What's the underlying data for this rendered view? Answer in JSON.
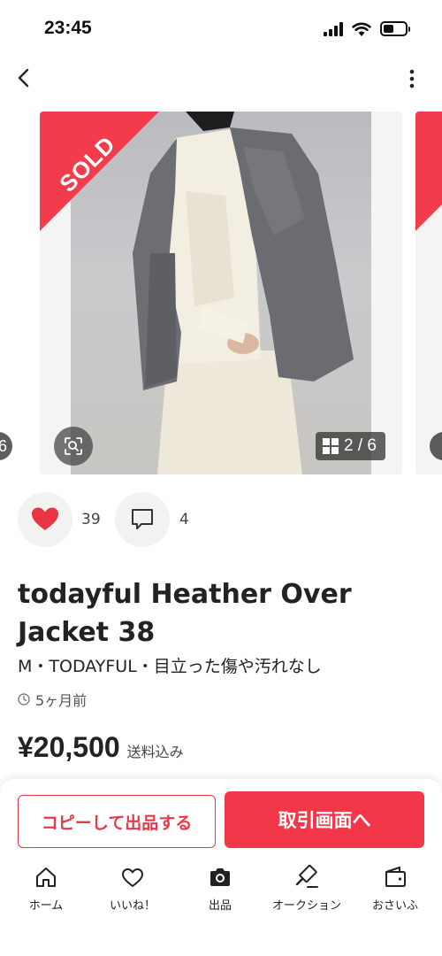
{
  "status_bar": {
    "time": "23:45"
  },
  "carousel": {
    "sold_label": "SOLD",
    "current_index": "2",
    "total": "6",
    "counter_text": "2 / 6",
    "prev_peek_text": "6"
  },
  "reactions": {
    "likes": "39",
    "comments": "4"
  },
  "item": {
    "title": "todayful Heather Over Jacket 38",
    "meta": "M・TODAYFUL・目立った傷や汚れなし",
    "posted": "5ヶ月前",
    "price": "¥20,500",
    "shipping": "送料込み"
  },
  "actions": {
    "copy_label": "コピーして出品する",
    "trade_label": "取引画面へ"
  },
  "tab_bar": {
    "items": [
      {
        "label": "ホーム",
        "icon": "home-icon"
      },
      {
        "label": "いいね！",
        "icon": "heart-outline-icon"
      },
      {
        "label": "出品",
        "icon": "camera-icon"
      },
      {
        "label": "オークション",
        "icon": "gavel-icon"
      },
      {
        "label": "おさいふ",
        "icon": "wallet-icon"
      }
    ]
  },
  "colors": {
    "brand_red": "#f23848",
    "like_red": "#ea3444"
  }
}
